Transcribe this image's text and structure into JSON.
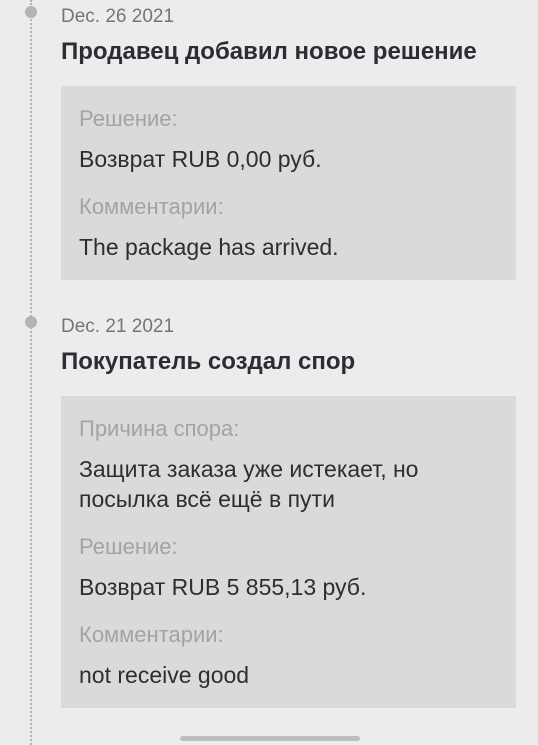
{
  "events": [
    {
      "date": "Dec. 26 2021",
      "title": "Продавец добавил новое решение",
      "fields": [
        {
          "label": "Решение:",
          "value": "Возврат RUB 0,00 руб."
        },
        {
          "label": "Комментарии:",
          "value": "The package has arrived."
        }
      ]
    },
    {
      "date": "Dec. 21 2021",
      "title": "Покупатель создал спор",
      "fields": [
        {
          "label": "Причина спора:",
          "value": "Защита заказа уже истекает, но посылка всё ещё в пути"
        },
        {
          "label": "Решение:",
          "value": "Возврат RUB 5 855,13 руб."
        },
        {
          "label": "Комментарии:",
          "value": "not receive good"
        }
      ]
    }
  ]
}
